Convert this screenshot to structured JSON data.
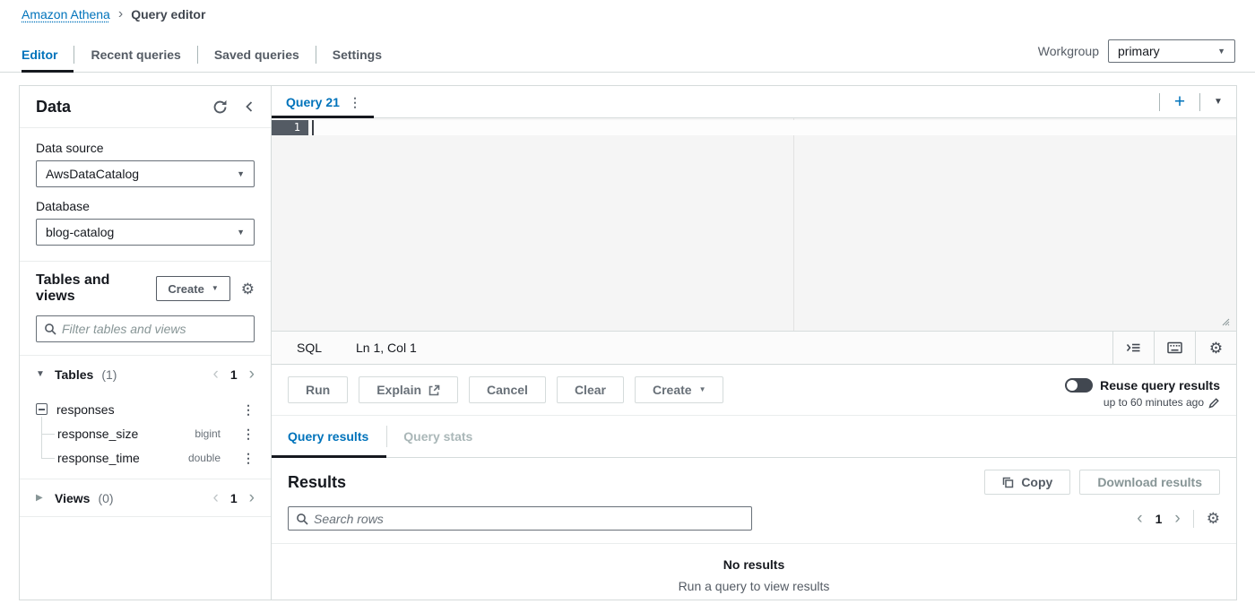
{
  "colors": {
    "accent": "#0073bb",
    "text_dark": "#16191f",
    "text_secondary": "#545b64",
    "text_muted": "#687078",
    "disabled": "#aab7b8",
    "border": "#d5dbdb",
    "divider": "#eaeded",
    "toggle_off": "#414750",
    "gutter_active": "#545b64"
  },
  "breadcrumb": {
    "link": "Amazon Athena",
    "current": "Query editor"
  },
  "nav": {
    "items": [
      {
        "label": "Editor"
      },
      {
        "label": "Recent queries"
      },
      {
        "label": "Saved queries"
      },
      {
        "label": "Settings"
      }
    ]
  },
  "workgroup": {
    "label": "Workgroup",
    "value": "primary"
  },
  "sidebar": {
    "title": "Data",
    "data_source_label": "Data source",
    "data_source_value": "AwsDataCatalog",
    "database_label": "Database",
    "database_value": "blog-catalog",
    "tables_views_title": "Tables and views",
    "create_label": "Create",
    "filter_placeholder": "Filter tables and views",
    "tables": {
      "label": "Tables",
      "count": "(1)",
      "page": "1"
    },
    "table_name": "responses",
    "columns": [
      {
        "name": "response_size",
        "type": "bigint"
      },
      {
        "name": "response_time",
        "type": "double"
      }
    ],
    "views": {
      "label": "Views",
      "count": "(0)",
      "page": "1"
    }
  },
  "query": {
    "tab_label": "Query 21",
    "line_number": "1",
    "lang": "SQL",
    "cursor_pos": "Ln 1, Col 1",
    "buttons": {
      "run": "Run",
      "explain": "Explain",
      "cancel": "Cancel",
      "clear": "Clear",
      "create": "Create"
    },
    "reuse_label": "Reuse query results",
    "reuse_sub": "up to 60 minutes ago"
  },
  "results": {
    "tab_results": "Query results",
    "tab_stats": "Query stats",
    "title": "Results",
    "copy": "Copy",
    "download": "Download results",
    "search_placeholder": "Search rows",
    "page": "1",
    "empty_title": "No results",
    "empty_sub": "Run a query to view results"
  },
  "glyphs": {
    "caret_down": "▼",
    "caret_right": "▶",
    "ellipsis": "⋮",
    "plus": "+",
    "gear": "⚙",
    "prev": "‹",
    "next": "›",
    "sep": "›"
  }
}
